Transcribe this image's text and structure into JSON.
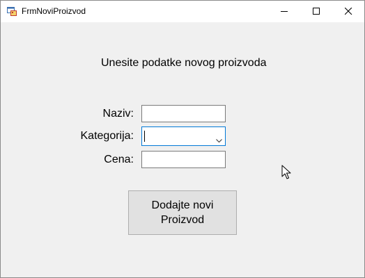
{
  "window": {
    "title": "FrmNoviProizvod",
    "controls": {
      "minimize_icon": "minimize-icon",
      "maximize_icon": "maximize-icon",
      "close_icon": "close-icon"
    }
  },
  "form": {
    "heading": "Unesite podatke novog proizvoda",
    "fields": {
      "naziv": {
        "label": "Naziv:",
        "value": ""
      },
      "kategorija": {
        "label": "Kategorija:",
        "value": ""
      },
      "cena": {
        "label": "Cena:",
        "value": ""
      }
    },
    "submit_button": {
      "line1": "Dodajte novi",
      "line2": "Proizvod"
    }
  },
  "colors": {
    "window_bg": "#f0f0f0",
    "titlebar_bg": "#ffffff",
    "focus_border": "#0078d7",
    "button_bg": "#e1e1e1",
    "button_border": "#adadad"
  }
}
